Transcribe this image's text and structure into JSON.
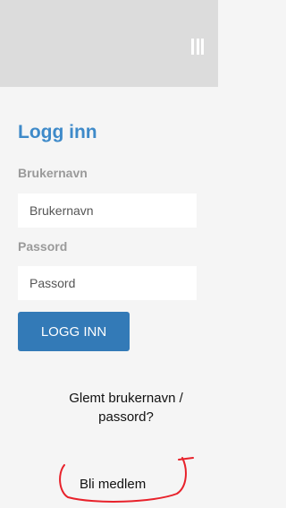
{
  "login": {
    "title": "Logg inn",
    "username_label": "Brukernavn",
    "username_placeholder": "Brukernavn",
    "password_label": "Passord",
    "password_placeholder": "Passord",
    "submit_label": "LOGG INN",
    "forgot_link": "Glemt brukernavn / passord?",
    "join_link": "Bli medlem"
  },
  "icons": {
    "menu": "hamburger-menu-icon"
  },
  "colors": {
    "accent": "#3e8ac9",
    "button": "#337ab7",
    "header_bg": "#dcdcdc",
    "annotation": "#e8222b"
  }
}
